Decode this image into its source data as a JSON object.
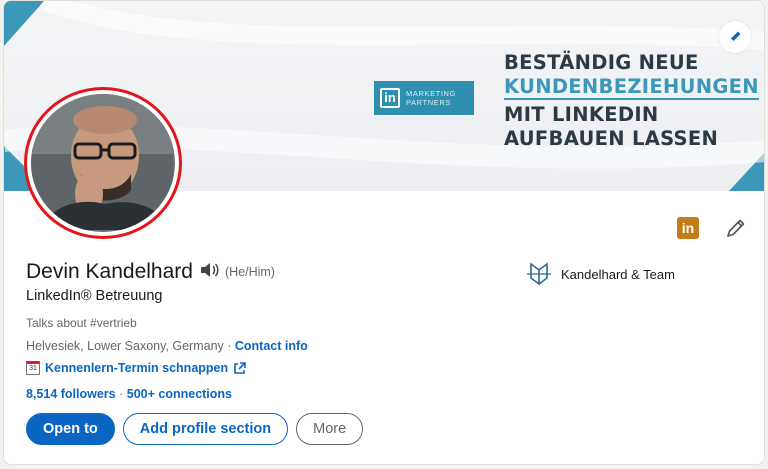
{
  "banner": {
    "brand_mark": "in",
    "brand_line1": "MARKETING",
    "brand_line2": "PARTNERS",
    "headline_line1": "BESTÄNDIG NEUE",
    "headline_line2": "KUNDENBEZIEHUNGEN",
    "headline_line3": "MIT LINKEDIN",
    "headline_line4": "AUFBAUEN LASSEN",
    "accent_color": "#3b98b8"
  },
  "profile": {
    "name": "Devin Kandelhard",
    "pronouns": "(He/Him)",
    "title": "LinkedIn® Betreuung",
    "talks_about": "Talks about #vertrieb",
    "location": "Helvesiek, Lower Saxony, Germany · ",
    "contact_info_label": "Contact info",
    "calendar_icon_text": "31",
    "calendar_link": "Kennenlern-Termin schnappen",
    "followers": "8,514 followers",
    "connections": "500+ connections",
    "linkedin_badge": "in"
  },
  "company": {
    "name": "Kandelhard & Team"
  },
  "actions": {
    "open_to": "Open to",
    "add_section": "Add profile section",
    "more": "More"
  },
  "colors": {
    "primary": "#0a66c2",
    "avatar_ring": "#e4151b",
    "badge": "#c37d16"
  }
}
